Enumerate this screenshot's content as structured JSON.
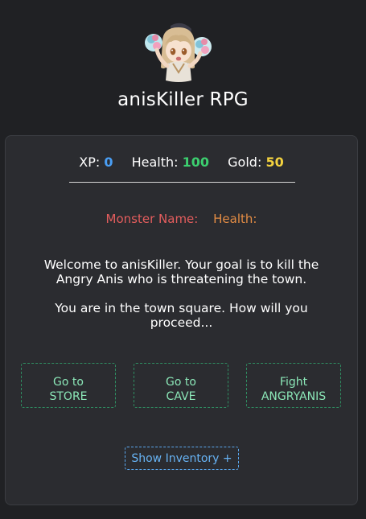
{
  "header": {
    "logo_icon": "chibi-character-with-pompoms-icon",
    "title": "anisKiller RPG"
  },
  "stats": {
    "xp_label": "XP:",
    "xp_value": "0",
    "health_label": "Health:",
    "health_value": "100",
    "gold_label": "Gold:",
    "gold_value": "50"
  },
  "monster": {
    "name_label": "Monster Name:",
    "health_label": "Health:"
  },
  "message": {
    "paragraph_1": "Welcome to anisKiller. Your goal is to kill the Angry Anis who is threatening the town.",
    "paragraph_2": "You are in the town square. How will you proceed..."
  },
  "actions": {
    "store_line_1": "Go to",
    "store_line_2": "STORE",
    "cave_line_1": "Go to",
    "cave_line_2": "CAVE",
    "fight_line_1": "Fight",
    "fight_line_2": "ANGRYANIS"
  },
  "inventory": {
    "label": "Show Inventory +"
  },
  "colors": {
    "background": "#202124",
    "panel": "#2b2c30",
    "xp": "#4a9ff5",
    "health": "#3ccf6f",
    "gold": "#f3d23f",
    "monster_name": "#e35d5d",
    "monster_health": "#e38c44",
    "action_button": "#8be6b7",
    "inventory_button": "#67b3f4"
  }
}
